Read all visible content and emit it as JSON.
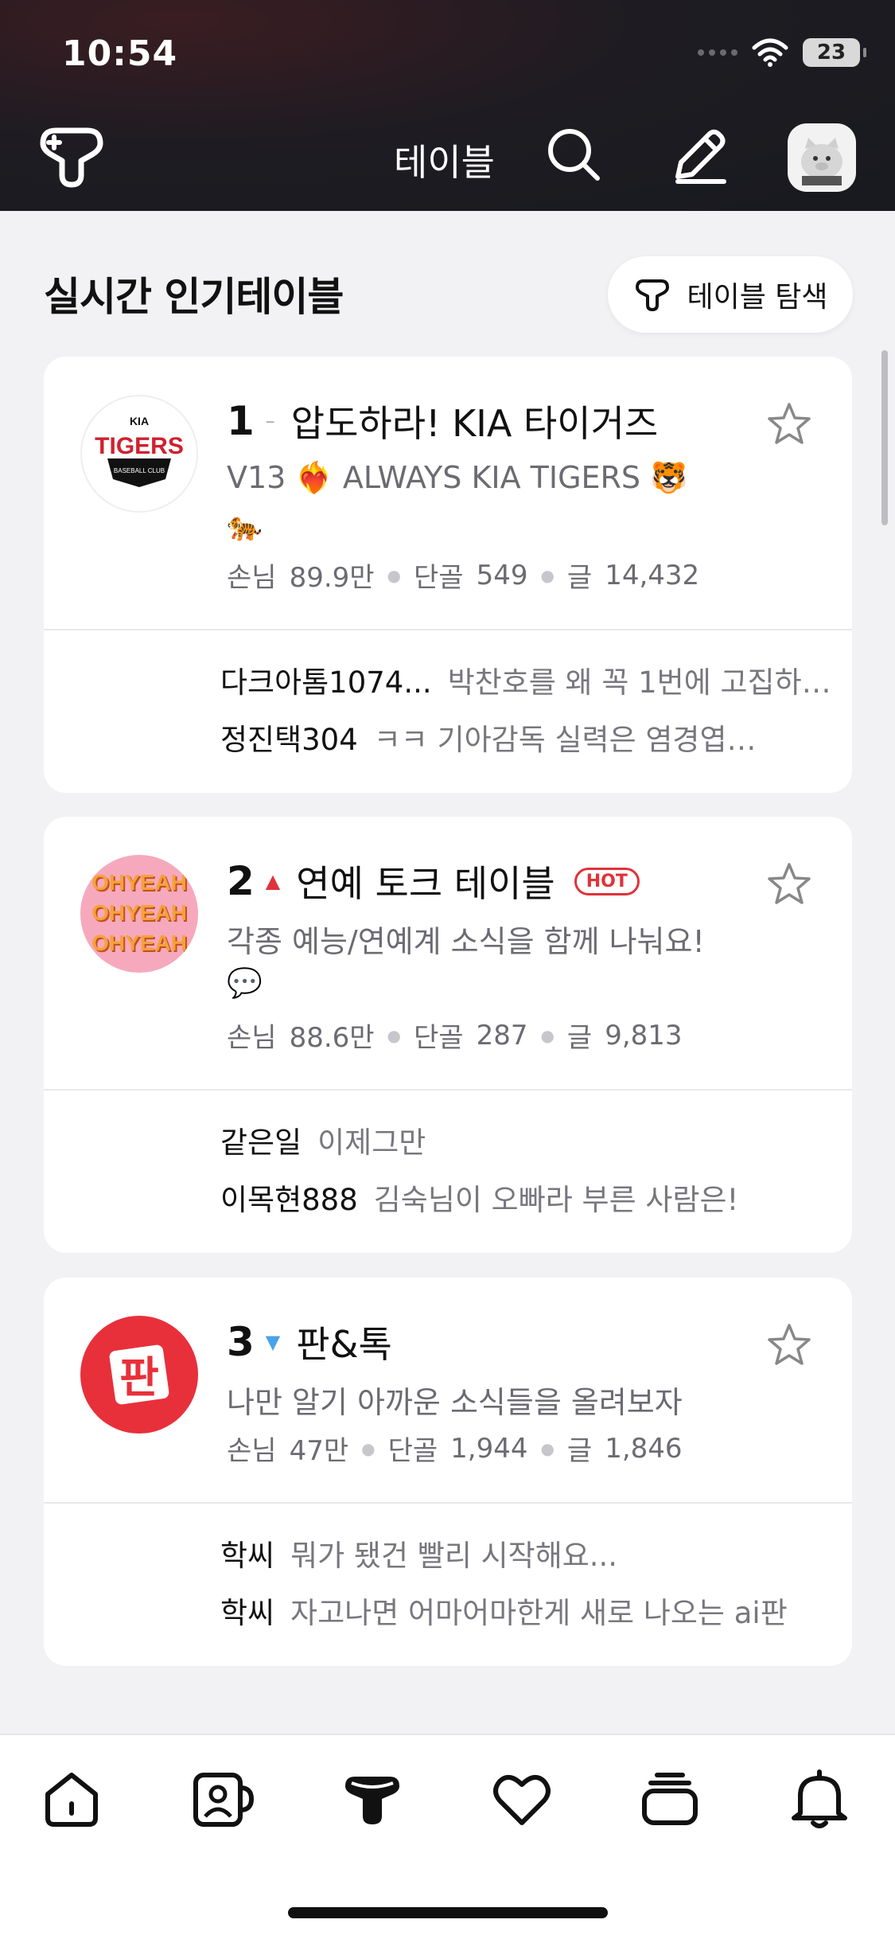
{
  "status_bar": {
    "time": "10:54",
    "battery": "23"
  },
  "nav": {
    "title": "테이블"
  },
  "section": {
    "title": "실시간 인기테이블",
    "explore_label": "테이블 탐색"
  },
  "tables": [
    {
      "rank": "1",
      "rank_mark": "–",
      "name": "압도하라! KIA 타이거즈",
      "hot": false,
      "desc": "V13 ❤️‍🔥 ALWAYS KIA TIGERS 🐯",
      "emoji": "🐅",
      "guests_label": "손님",
      "guests": "89.9만",
      "regulars_label": "단골",
      "regulars": "549",
      "posts_label": "글",
      "posts": "14,432",
      "logo_text": "TIGERS",
      "comments": [
        {
          "author": "다크아톰1074...",
          "text": "박찬호를 왜 꼭 1번에 고집하…"
        },
        {
          "author": "정진택304",
          "text": "ㅋㅋ 기아감독 실력은 염경엽이 반…"
        }
      ]
    },
    {
      "rank": "2",
      "rank_mark": "▲",
      "name": "연예 토크 테이블",
      "hot": true,
      "hot_label": "HOT",
      "desc": "각종 예능/연예계 소식을 함께 나눠요!",
      "emoji": "💬",
      "guests_label": "손님",
      "guests": "88.6만",
      "regulars_label": "단골",
      "regulars": "287",
      "posts_label": "글",
      "posts": "9,813",
      "logo_text": "OHYEAH",
      "comments": [
        {
          "author": "같은일",
          "text": "이제그만"
        },
        {
          "author": "이목현888",
          "text": "김숙님이 오빠라 부른 사람은!"
        }
      ]
    },
    {
      "rank": "3",
      "rank_mark": "▼",
      "name": "판&톡",
      "hot": false,
      "desc": "나만 알기 아까운 소식들을 올려보자",
      "emoji": "",
      "guests_label": "손님",
      "guests": "47만",
      "regulars_label": "단골",
      "regulars": "1,944",
      "posts_label": "글",
      "posts": "1,846",
      "logo_text": "판",
      "comments": [
        {
          "author": "학씨",
          "text": "뭐가 됐건 빨리 시작해요..."
        },
        {
          "author": "학씨",
          "text": "자고나면 어마어마한게 새로 나오는 ai판"
        }
      ]
    }
  ],
  "tab_bar": {
    "items": [
      {
        "icon": "home-icon"
      },
      {
        "icon": "profile-mug-icon"
      },
      {
        "icon": "table-icon"
      },
      {
        "icon": "heart-icon"
      },
      {
        "icon": "stack-icon"
      },
      {
        "icon": "bell-icon"
      }
    ]
  },
  "colors": {
    "accent_red": "#e0323a",
    "rank_up": "#e0323a",
    "rank_down": "#4aa3e8"
  }
}
